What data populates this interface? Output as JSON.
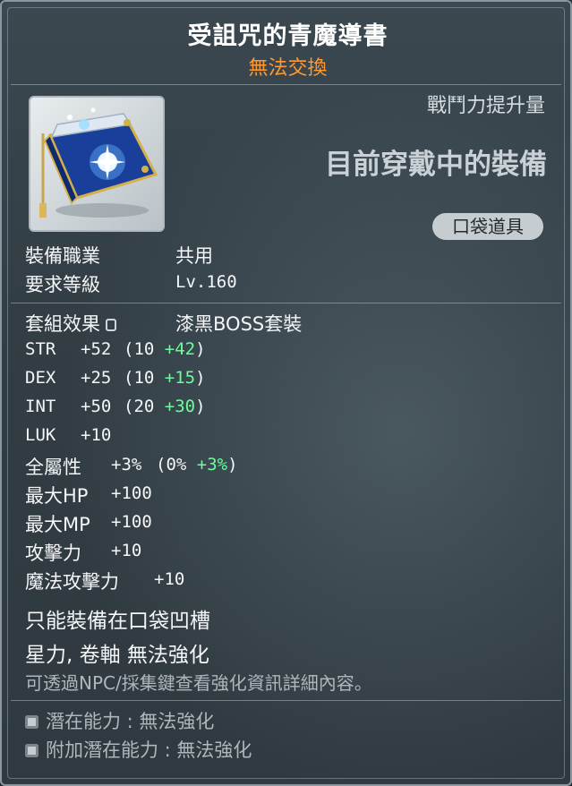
{
  "item": {
    "name": "受詛咒的青魔導書",
    "trade_status": "無法交換",
    "combat_power_label": "戰鬥力提升量",
    "equipped_label": "目前穿戴中的裝備",
    "category": "口袋道具",
    "icon": "blue-grimoire-icon"
  },
  "requirements": {
    "job_label": "裝備職業",
    "job_value": "共用",
    "level_label": "要求等級",
    "level_value": "Lv.160"
  },
  "set_effect": {
    "label": "套組效果",
    "value": "漆黑BOSS套裝"
  },
  "stats": [
    {
      "name": "STR",
      "total": "+52",
      "base": "10",
      "bonus": "+42"
    },
    {
      "name": "DEX",
      "total": "+25",
      "base": "10",
      "bonus": "+15"
    },
    {
      "name": "INT",
      "total": "+50",
      "base": "20",
      "bonus": "+30"
    },
    {
      "name": "LUK",
      "total": "+10"
    },
    {
      "name": "全屬性",
      "total": "+3%",
      "base": "0%",
      "bonus": "+3%"
    },
    {
      "name": "最大HP",
      "total": "+100"
    },
    {
      "name": "最大MP",
      "total": "+100"
    },
    {
      "name": "攻擊力",
      "total": "+10"
    },
    {
      "name": "魔法攻擊力",
      "total": "+10"
    }
  ],
  "notes": {
    "slot_only": "只能裝備在口袋凹槽",
    "enhance": "星力, 卷軸 無法強化",
    "npc_hint": "可透過NPC/採集鍵查看強化資訊詳細內容。"
  },
  "potential": {
    "potential_label": "潛在能力 : 無法強化",
    "additional_label": "附加潛在能力 : 無法強化"
  },
  "colors": {
    "trade_status": "#ff9933",
    "bonus": "#66ff99",
    "background": "#323d44"
  }
}
